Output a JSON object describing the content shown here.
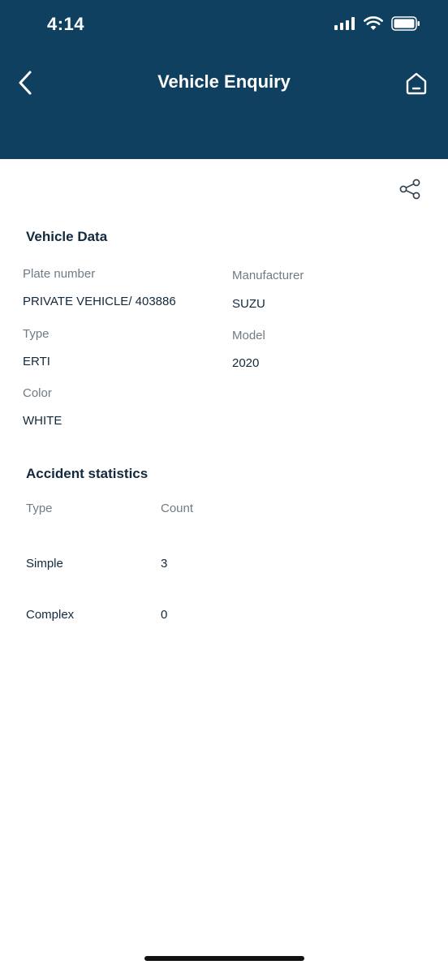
{
  "status_bar": {
    "time": "4:14"
  },
  "nav": {
    "title": "Vehicle Enquiry",
    "back_icon": "chevron-left-icon",
    "home_icon": "home-icon"
  },
  "share": {
    "icon": "share-icon"
  },
  "vehicle_data": {
    "title": "Vehicle Data",
    "plate_number_label": "Plate number",
    "plate_number_value": "PRIVATE VEHICLE/ 403886",
    "manufacturer_label": "Manufacturer",
    "manufacturer_value": "SUZU",
    "type_label": "Type",
    "type_value": "ERTI",
    "model_label": "Model",
    "model_value": "2020",
    "color_label": "Color",
    "color_value": "WHITE"
  },
  "accident_statistics": {
    "title": "Accident statistics",
    "columns": [
      "Type",
      "Count"
    ],
    "rows": [
      {
        "type": "Simple",
        "count": "3"
      },
      {
        "type": "Complex",
        "count": "0"
      }
    ]
  },
  "colors": {
    "header_bg": "#0f4060",
    "text_primary": "#13293d",
    "text_secondary": "#6f7b85"
  }
}
